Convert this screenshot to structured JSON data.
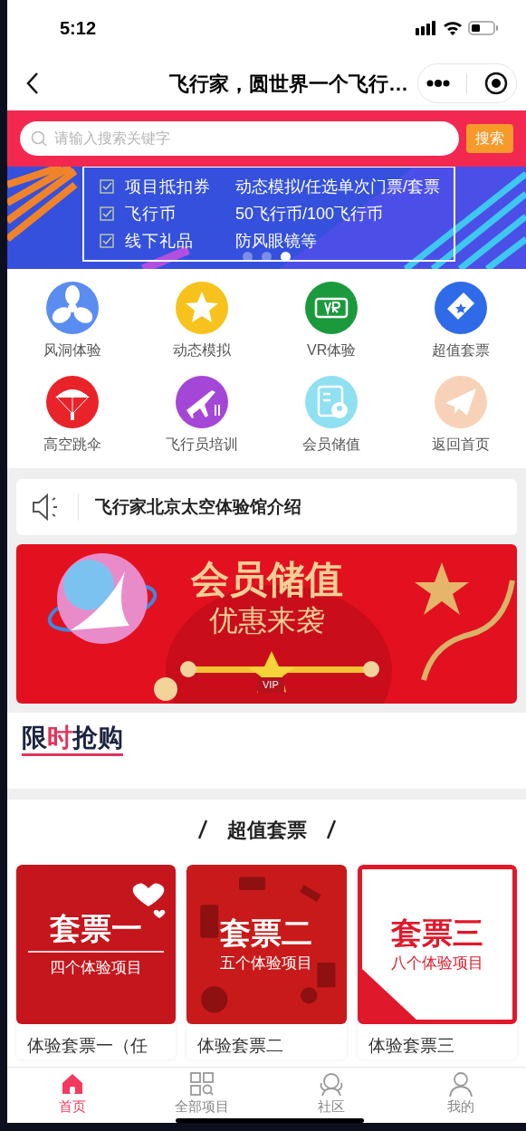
{
  "status_bar": {
    "time": "5:12"
  },
  "nav": {
    "title": "飞行家，圆世界一个飞行…"
  },
  "search": {
    "placeholder": "请输入搜索关键字",
    "button": "搜索"
  },
  "carousel": {
    "lines": [
      {
        "item": "项目抵扣券",
        "detail": "动态模拟/任选单次门票/套票"
      },
      {
        "item": "飞行币",
        "detail": "50飞行币/100飞行币"
      },
      {
        "item": "线下礼品",
        "detail": "防风眼镜等"
      }
    ],
    "dots": [
      {
        "selected": false
      },
      {
        "selected": false
      },
      {
        "selected": true
      }
    ]
  },
  "categories": [
    {
      "label": "风洞体验",
      "kind": "fan",
      "color": "#5b8cf0"
    },
    {
      "label": "动态模拟",
      "kind": "star",
      "color": "#f7c21c"
    },
    {
      "label": "VR体验",
      "kind": "vr",
      "color": "#1a9a3c"
    },
    {
      "label": "超值套票",
      "kind": "ticket",
      "color": "#2f6be8"
    },
    {
      "label": "高空跳伞",
      "kind": "parachute",
      "color": "#e8232a"
    },
    {
      "label": "飞行员培训",
      "kind": "plane",
      "color": "#a447d6"
    },
    {
      "label": "会员储值",
      "kind": "card",
      "color": "#8fe0f0"
    },
    {
      "label": "返回首页",
      "kind": "paper",
      "color": "#f8d2b8"
    }
  ],
  "notice": {
    "text": "飞行家北京太空体验馆介绍"
  },
  "promo": {
    "title": "会员储值",
    "subtitle": "优惠来袭",
    "badge": "VIP"
  },
  "flash_sale": {
    "chars": [
      {
        "text": "限",
        "accent": false
      },
      {
        "text": "时",
        "accent": true
      },
      {
        "text": "抢",
        "accent": false
      },
      {
        "text": "购",
        "accent": false
      }
    ]
  },
  "section": {
    "title": "超值套票"
  },
  "packages": [
    {
      "cover_title": "套票一",
      "cover_subtitle": "四个体验项目",
      "kind": "heart",
      "name": "体验套票一（任"
    },
    {
      "cover_title": "套票二",
      "cover_subtitle": "五个体验项目",
      "kind": "pattern",
      "name": "体验套票二"
    },
    {
      "cover_title": "套票三",
      "cover_subtitle": "八个体验项目",
      "kind": "frame",
      "name": "体验套票三"
    }
  ],
  "tab_bar": [
    {
      "label": "首页",
      "kind": "home",
      "selected": true
    },
    {
      "label": "全部项目",
      "kind": "grid",
      "selected": false
    },
    {
      "label": "社区",
      "kind": "community",
      "selected": false
    },
    {
      "label": "我的",
      "kind": "user",
      "selected": false
    }
  ]
}
